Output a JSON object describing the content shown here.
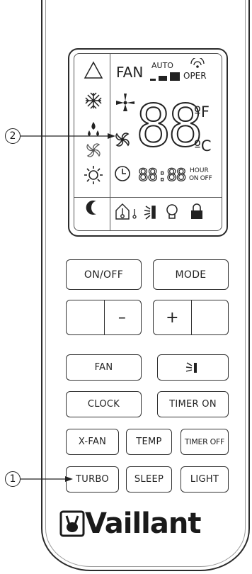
{
  "lcd": {
    "fan_label": "FAN",
    "auto_label": "AUTO",
    "oper_label": "OPER",
    "temp_digits": "88",
    "unit_f": "ºF",
    "unit_c": "ºC",
    "clock_digits": "88:88",
    "hour_label": "HOUR",
    "on_off_label": "ON OFF"
  },
  "buttons": {
    "on_off": "ON/OFF",
    "mode": "MODE",
    "minus": "–",
    "plus": "+",
    "fan": "FAN",
    "clock": "CLOCK",
    "timer_on": "TIMER ON",
    "x_fan": "X-FAN",
    "temp": "TEMP",
    "timer_off": "TIMER OFF",
    "turbo": "TURBO",
    "sleep": "SLEEP",
    "light": "LIGHT"
  },
  "callouts": {
    "one": "1",
    "two": "2"
  },
  "brand": {
    "name": "Vaillant"
  }
}
